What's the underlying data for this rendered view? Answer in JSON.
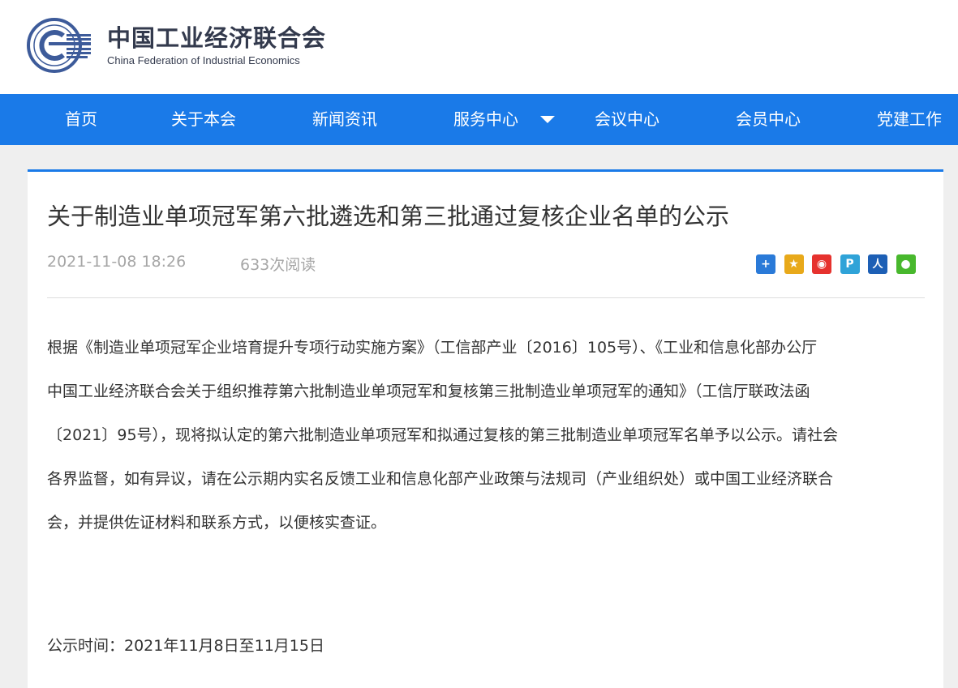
{
  "org": {
    "name_cn": "中国工业经济联合会",
    "name_en": "China Federation of Industrial Economics"
  },
  "nav": {
    "items": [
      "首页",
      "关于本会",
      "新闻资讯",
      "服务中心",
      "会议中心",
      "会员中心",
      "党建工作"
    ]
  },
  "article": {
    "title": "关于制造业单项冠军第六批遴选和第三批通过复核企业名单的公示",
    "date": "2021-11-08 18:26",
    "views": "633次阅读",
    "body_lines": [
      "根据《制造业单项冠军企业培育提升专项行动实施方案》（工信部产业〔2016〕105号）、《工业和信息化部办公厅",
      "中国工业经济联合会关于组织推荐第六批制造业单项冠军和复核第三批制造业单项冠军的通知》（工信厅联政法函",
      "〔2021〕95号），现将拟认定的第六批制造业单项冠军和拟通过复核的第三批制造业单项冠军名单予以公示。请社会",
      "各界监督，如有异议，请在公示期内实名反馈工业和信息化部产业政策与法规司（产业组织处）或中国工业经济联合",
      "会，并提供佐证材料和联系方式，以便核实查证。"
    ],
    "publish_period": "公示时间：2021年11月8日至11月15日"
  },
  "share": {
    "icons": [
      {
        "name": "share-more-icon",
        "glyph": "+",
        "color": "#2a7ad8"
      },
      {
        "name": "qzone-icon",
        "glyph": "★",
        "color": "#e8a91a"
      },
      {
        "name": "weibo-icon",
        "glyph": "◉",
        "color": "#e6322e"
      },
      {
        "name": "tencent-weibo-icon",
        "glyph": "P",
        "color": "#2fa3d8"
      },
      {
        "name": "renren-icon",
        "glyph": "人",
        "color": "#1d5fb5"
      },
      {
        "name": "wechat-icon",
        "glyph": "●",
        "color": "#48b82d"
      }
    ]
  },
  "colors": {
    "nav_bg": "#1a7ae8",
    "logo_blue": "#3d5b9a",
    "text": "#333333",
    "muted": "#a6a6a6"
  }
}
